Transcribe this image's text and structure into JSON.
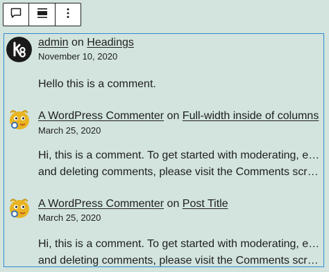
{
  "toolbar": {
    "buttons": [
      {
        "icon": "comment-icon"
      },
      {
        "icon": "align-full-icon"
      },
      {
        "icon": "more-options-icon"
      }
    ]
  },
  "comments": [
    {
      "author": "admin",
      "on": "on",
      "post": "Headings",
      "date": "November 10, 2020",
      "lines": [
        "Hello this is a comment."
      ],
      "avatar": "k8-logo-avatar"
    },
    {
      "author": "A WordPress Commenter",
      "on": "on",
      "post": "Full-width inside of columns",
      "date": "March 25, 2020",
      "lines": [
        "Hi, this is a comment. To get started with moderating, editing,",
        "and deleting comments, please visit the Comments screen in…"
      ],
      "avatar": "wapuu-avatar"
    },
    {
      "author": "A WordPress Commenter",
      "on": "on",
      "post": "Post Title",
      "date": "March 25, 2020",
      "lines": [
        "Hi, this is a comment. To get started with moderating, editing,",
        "and deleting comments, please visit the Comments screen in…"
      ],
      "avatar": "wapuu-avatar"
    }
  ],
  "colors": {
    "background": "#d2e4dd",
    "selection_border": "#2f8ad5",
    "text": "#1e1e1e"
  }
}
